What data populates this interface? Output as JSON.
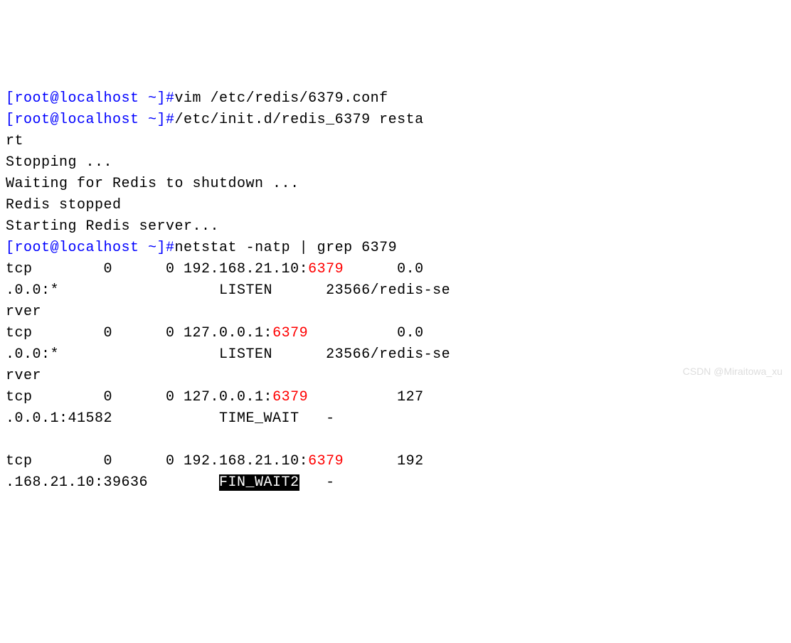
{
  "lines": {
    "l1_prompt": "[root@localhost ~]#",
    "l1_cmd": "vim /etc/redis/6379.conf",
    "l2_prompt": "[root@localhost ~]#",
    "l2_cmd": "/etc/init.d/redis_6379 resta",
    "l3": "rt",
    "l4": "Stopping ...",
    "l5": "Waiting for Redis to shutdown ...",
    "l6": "Redis stopped",
    "l7": "Starting Redis server...",
    "l8_prompt": "[root@localhost ~]#",
    "l8_cmd": "netstat -natp | grep 6379",
    "l9a": "tcp        0      0 192.168.21.10:",
    "l9_port": "6379",
    "l9b": "      0.0",
    "l10a": ".0.0:*                  LISTEN      23566/redis-se",
    "l11": "rver",
    "l12a": "tcp        0      0 127.0.0.1:",
    "l12_port": "6379",
    "l12b": "          0.0",
    "l13a": ".0.0:*                  LISTEN      23566/redis-se",
    "l14": "rver",
    "l15a": "tcp        0      0 127.0.0.1:",
    "l15_port": "6379",
    "l15b": "          127",
    "l16": ".0.0.1:41582            TIME_WAIT   -",
    "l17": "",
    "l18a": "tcp        0      0 192.168.21.10:",
    "l18_port": "6379",
    "l18b": "      192",
    "l19a": ".168.21.10:39636        ",
    "l19_inv": "FIN_WAIT2",
    "l19b": "   -"
  },
  "watermark": "CSDN @Miraitowa_xu"
}
